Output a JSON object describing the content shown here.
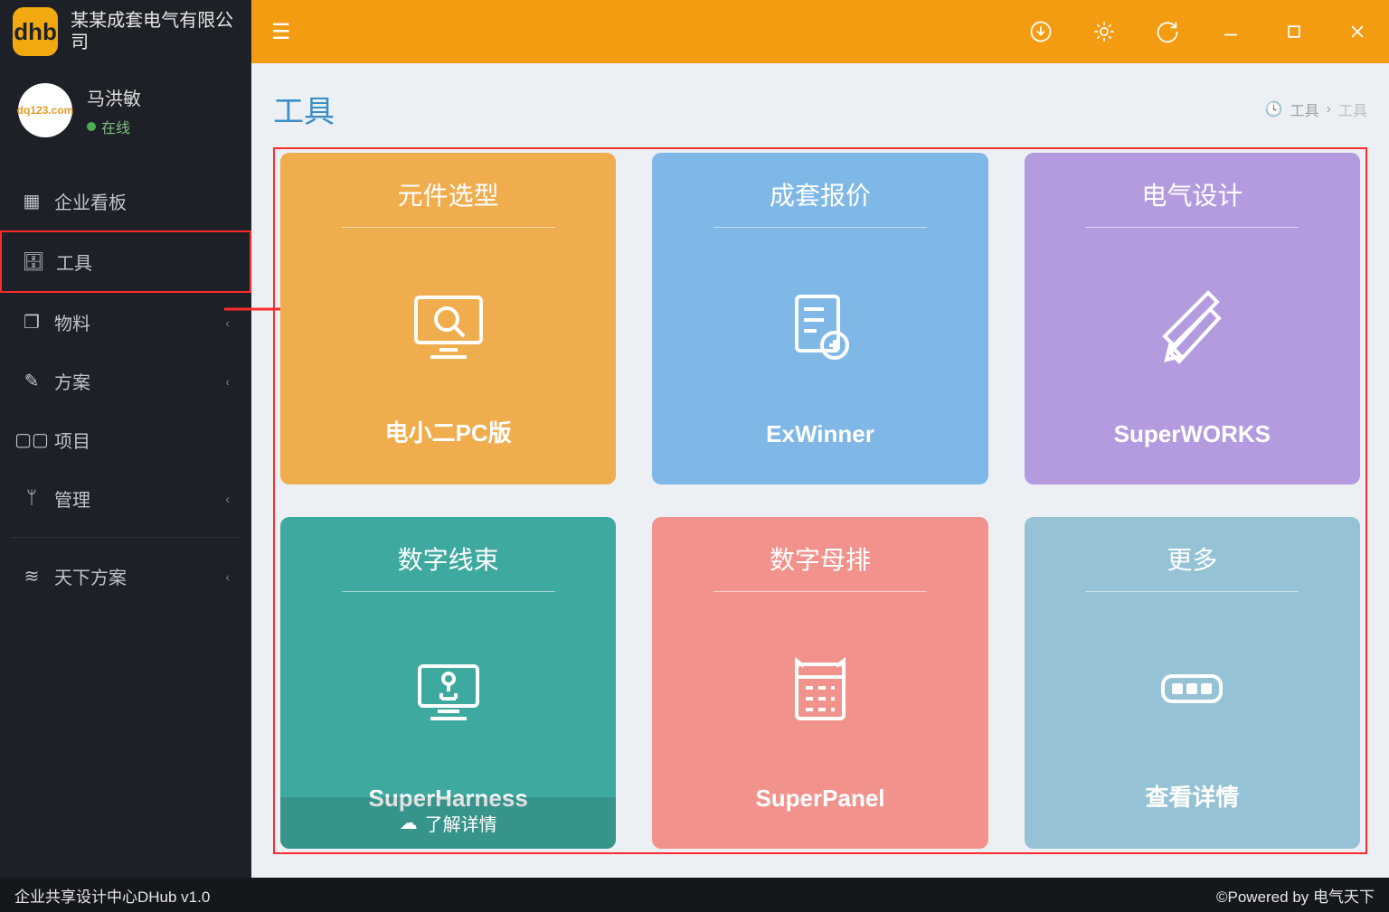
{
  "brand": {
    "name": "某某成套电气有限公司",
    "logo_text": "dhb"
  },
  "user": {
    "name": "马洪敏",
    "status": "在线",
    "avatar_text": "dq123.com"
  },
  "sidebar": {
    "items": [
      {
        "label": "企业看板",
        "icon": "dashboard-icon",
        "expandable": false
      },
      {
        "label": "工具",
        "icon": "briefcase-icon",
        "expandable": false
      },
      {
        "label": "物料",
        "icon": "cube-icon",
        "expandable": true
      },
      {
        "label": "方案",
        "icon": "edit-icon",
        "expandable": true
      },
      {
        "label": "项目",
        "icon": "grid-icon",
        "expandable": false
      },
      {
        "label": "管理",
        "icon": "sitemap-icon",
        "expandable": true
      }
    ],
    "items2": [
      {
        "label": "天下方案",
        "icon": "layers-icon",
        "expandable": true
      }
    ]
  },
  "page": {
    "title": "工具",
    "breadcrumb": {
      "root": "工具",
      "leaf": "工具"
    }
  },
  "cards": [
    {
      "title": "元件选型",
      "caption": "电小二PC版",
      "color": "c1",
      "icon": "monitor-search-icon"
    },
    {
      "title": "成套报价",
      "caption": "ExWinner",
      "color": "c2",
      "icon": "invoice-icon"
    },
    {
      "title": "电气设计",
      "caption": "SuperWORKS",
      "color": "c3",
      "icon": "design-icon"
    },
    {
      "title": "数字线束",
      "caption": "SuperHarness",
      "color": "c4",
      "icon": "harness-icon",
      "details": "了解详情"
    },
    {
      "title": "数字母排",
      "caption": "SuperPanel",
      "color": "c5",
      "icon": "panel-icon"
    },
    {
      "title": "更多",
      "caption": "查看详情",
      "color": "c6",
      "icon": "more-icon"
    }
  ],
  "footer": {
    "left": "企业共享设计中心DHub v1.0",
    "right": "©Powered by 电气天下"
  }
}
